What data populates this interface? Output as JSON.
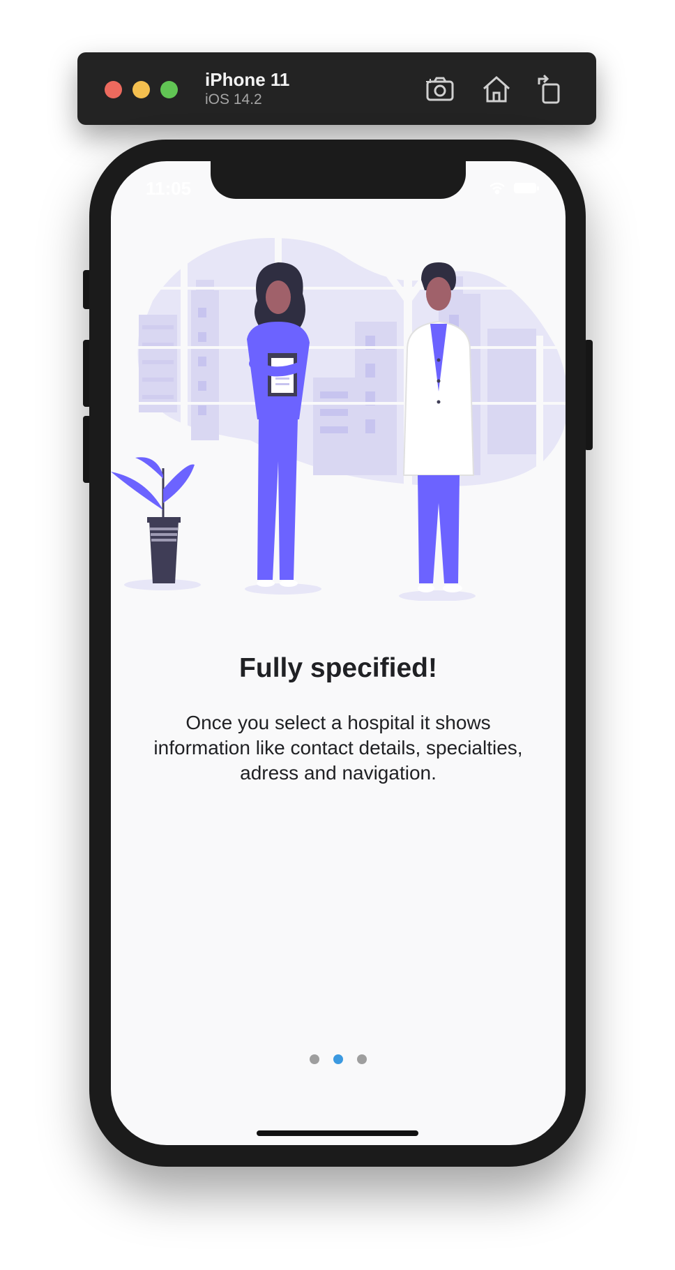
{
  "simulator": {
    "device_name": "iPhone 11",
    "os_version": "iOS 14.2",
    "toolbar_icons": [
      "screenshot-icon",
      "home-icon",
      "rotate-icon"
    ]
  },
  "status_bar": {
    "time": "11:05",
    "icons": [
      "wifi-icon",
      "battery-icon"
    ]
  },
  "onboarding": {
    "illustration": "doctors-illustration",
    "title": "Fully specified!",
    "description": "Once you select a hospital it shows information like contact details, specialties, adress and navigation.",
    "page_count": 3,
    "current_page": 2
  },
  "colors": {
    "accent": "#6c63ff",
    "active_dot": "#3b99e0",
    "inactive_dot": "#9e9e9e",
    "text": "#202124"
  }
}
